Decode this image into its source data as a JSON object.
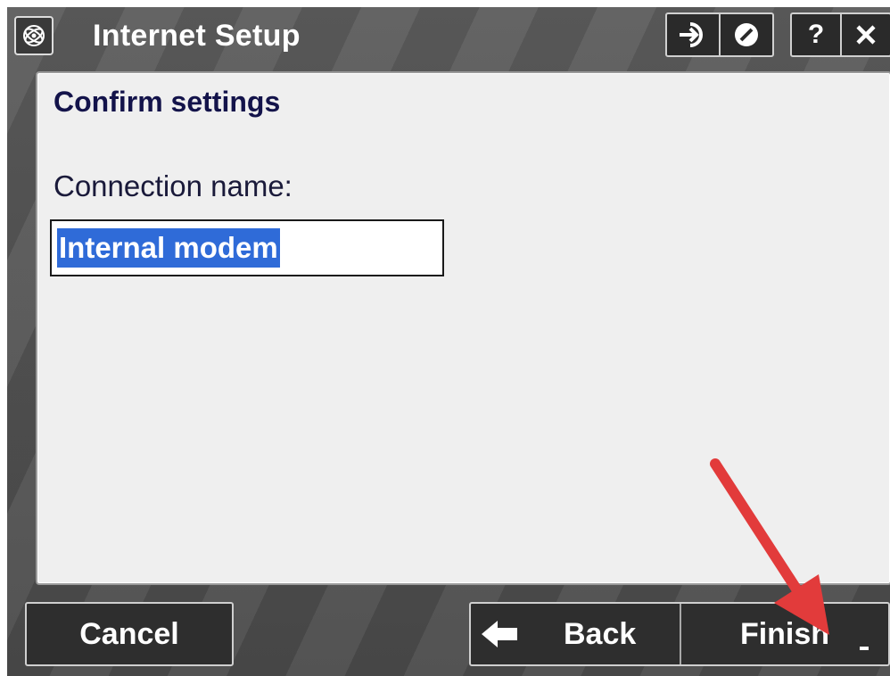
{
  "window": {
    "title": "Internet Setup",
    "icons": [
      "app-logo-icon",
      "enter-icon",
      "stop-icon",
      "help-icon",
      "close-icon"
    ],
    "help_label": "?"
  },
  "form": {
    "heading": "Confirm settings",
    "connection_label": "Connection name:",
    "connection_value": "Internal modem"
  },
  "buttons": {
    "cancel": "Cancel",
    "back": "Back",
    "finish": "Finish"
  },
  "colors": {
    "selection": "#2f6bd8",
    "annotation_arrow": "#e23b3b",
    "heading_text": "#13134a"
  }
}
